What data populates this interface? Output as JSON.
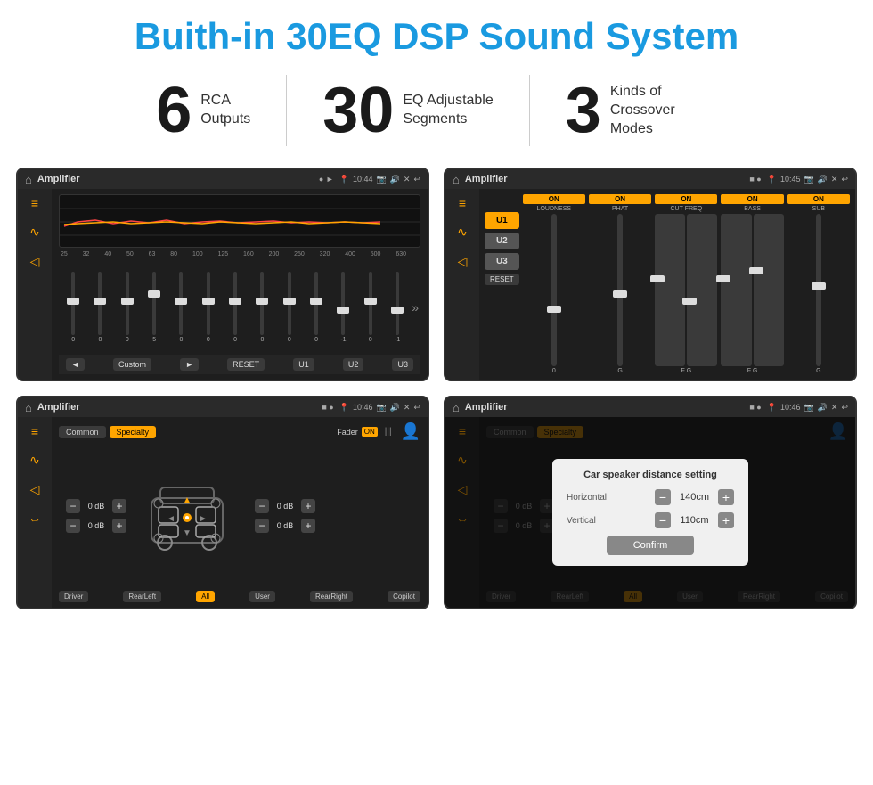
{
  "page": {
    "main_title": "Buith-in 30EQ DSP Sound System",
    "stats": [
      {
        "number": "6",
        "label": "RCA\nOutputs"
      },
      {
        "number": "30",
        "label": "EQ Adjustable\nSegments"
      },
      {
        "number": "3",
        "label": "Kinds of\nCrossover Modes"
      }
    ]
  },
  "screen1": {
    "status_bar": {
      "app_title": "Amplifier",
      "time": "10:44"
    },
    "freq_labels": [
      "25",
      "32",
      "40",
      "50",
      "63",
      "80",
      "100",
      "125",
      "160",
      "200",
      "250",
      "320",
      "400",
      "500",
      "630"
    ],
    "slider_values": [
      "0",
      "0",
      "0",
      "5",
      "0",
      "0",
      "0",
      "0",
      "0",
      "0",
      "-1",
      "0",
      "-1"
    ],
    "nav_buttons": [
      "◄",
      "Custom",
      "►",
      "RESET",
      "U1",
      "U2",
      "U3"
    ]
  },
  "screen2": {
    "status_bar": {
      "app_title": "Amplifier",
      "time": "10:45"
    },
    "u_buttons": [
      "U1",
      "U2",
      "U3"
    ],
    "controls": [
      {
        "label": "LOUDNESS",
        "on": true
      },
      {
        "label": "PHAT",
        "on": true
      },
      {
        "label": "CUT FREQ",
        "on": true
      },
      {
        "label": "BASS",
        "on": true
      },
      {
        "label": "SUB",
        "on": true
      }
    ],
    "reset_label": "RESET"
  },
  "screen3": {
    "status_bar": {
      "app_title": "Amplifier",
      "time": "10:46"
    },
    "tabs": [
      "Common",
      "Specialty"
    ],
    "fader_label": "Fader",
    "on_label": "ON",
    "db_rows": [
      {
        "value": "0 dB"
      },
      {
        "value": "0 dB"
      },
      {
        "value": "0 dB"
      },
      {
        "value": "0 dB"
      }
    ],
    "bottom_buttons": [
      "Driver",
      "RearLeft",
      "All",
      "User",
      "RearRight",
      "Copilot"
    ]
  },
  "screen4": {
    "status_bar": {
      "app_title": "Amplifier",
      "time": "10:46"
    },
    "tabs": [
      "Common",
      "Specialty"
    ],
    "dialog": {
      "title": "Car speaker distance setting",
      "rows": [
        {
          "label": "Horizontal",
          "value": "140cm"
        },
        {
          "label": "Vertical",
          "value": "110cm"
        }
      ],
      "confirm_label": "Confirm"
    },
    "db_rows": [
      {
        "value": "0 dB"
      },
      {
        "value": "0 dB"
      }
    ],
    "bottom_buttons": [
      "Driver",
      "RearLeft",
      "All",
      "User",
      "RearRight",
      "Copilot"
    ]
  },
  "icons": {
    "home": "⌂",
    "eq": "≡",
    "wave": "∿",
    "volume": "◁",
    "arrow_left": "◄",
    "arrow_right": "►",
    "settings": "⚙",
    "person": "👤"
  }
}
